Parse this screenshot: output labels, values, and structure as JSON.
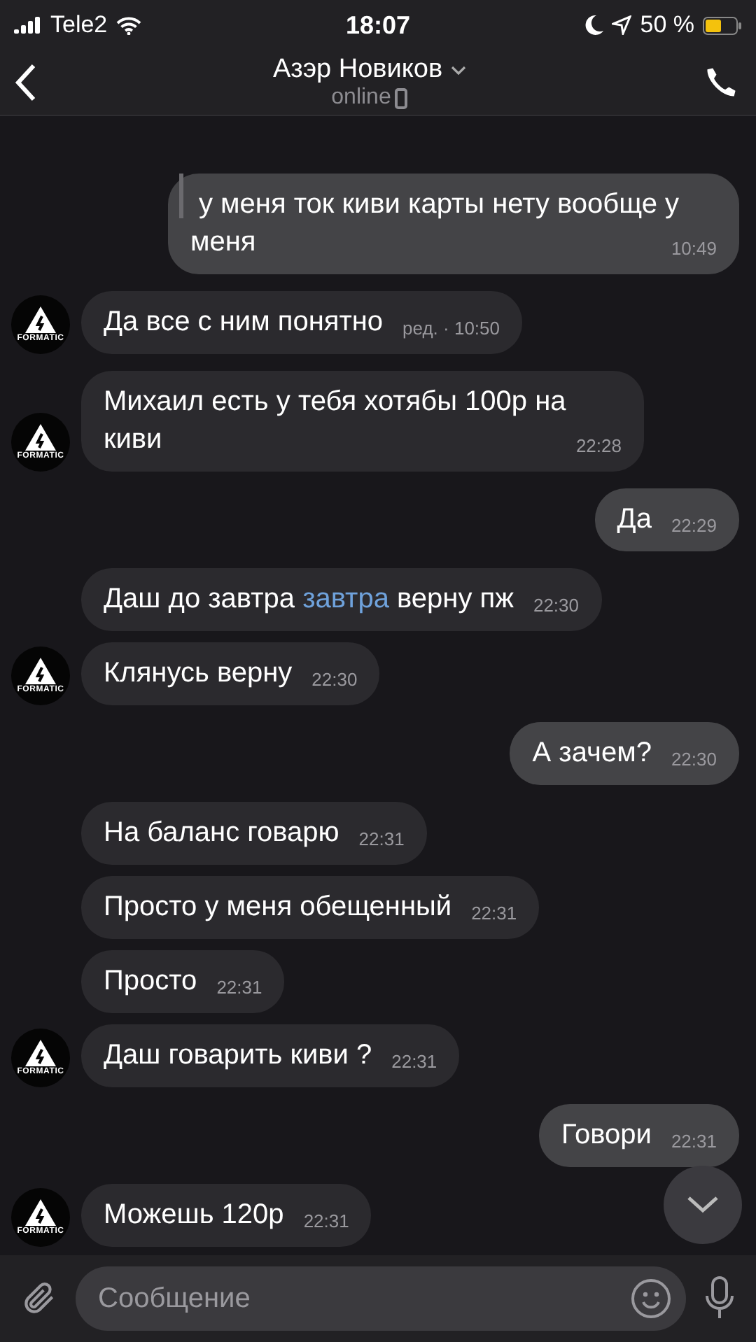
{
  "status_bar": {
    "carrier": "Tele2",
    "time": "18:07",
    "battery": "50 %"
  },
  "header": {
    "title": "Азэр Новиков",
    "subtitle": "online"
  },
  "messages": [
    {
      "kind": "out",
      "quote": true,
      "parts": [
        {
          "text": "у меня ток киви карты нету вообще у меня"
        }
      ],
      "time": "10:49"
    },
    {
      "kind": "in",
      "parts": [
        {
          "text": "Да все с ним понятно"
        }
      ],
      "time": "ред. · 10:50",
      "avatar": {
        "label": "FORMATIC"
      }
    },
    {
      "kind": "in",
      "parts": [
        {
          "text": "Михаил есть у тебя хотябы 100р на киви"
        }
      ],
      "time": "22:28",
      "avatar": {
        "label": "FORMATIC"
      }
    },
    {
      "kind": "out",
      "parts": [
        {
          "text": "Да"
        }
      ],
      "time": "22:29"
    },
    {
      "kind": "in",
      "parts": [
        {
          "text": "Даш до завтра "
        },
        {
          "text": "завтра",
          "link": true
        },
        {
          "text": " верну пж"
        }
      ],
      "time": "22:30"
    },
    {
      "kind": "in",
      "parts": [
        {
          "text": "Клянусь верну"
        }
      ],
      "time": "22:30",
      "avatar": {
        "label": "FORMATIC"
      }
    },
    {
      "kind": "out",
      "parts": [
        {
          "text": "А зачем?"
        }
      ],
      "time": "22:30"
    },
    {
      "kind": "in",
      "parts": [
        {
          "text": "На баланс говарю"
        }
      ],
      "time": "22:31"
    },
    {
      "kind": "in",
      "parts": [
        {
          "text": "Просто у меня обещенный"
        }
      ],
      "time": "22:31"
    },
    {
      "kind": "in",
      "parts": [
        {
          "text": "Просто"
        }
      ],
      "time": "22:31"
    },
    {
      "kind": "in",
      "parts": [
        {
          "text": "Даш говарить киви ?"
        }
      ],
      "time": "22:31",
      "avatar": {
        "label": "FORMATIC"
      }
    },
    {
      "kind": "out",
      "parts": [
        {
          "text": "Говори"
        }
      ],
      "time": "22:31"
    },
    {
      "kind": "in",
      "parts": [
        {
          "text": "Можешь 120р"
        }
      ],
      "time": "22:31",
      "avatar": {
        "label": "FORMATIC"
      }
    }
  ],
  "composer": {
    "placeholder": "Сообщение"
  }
}
